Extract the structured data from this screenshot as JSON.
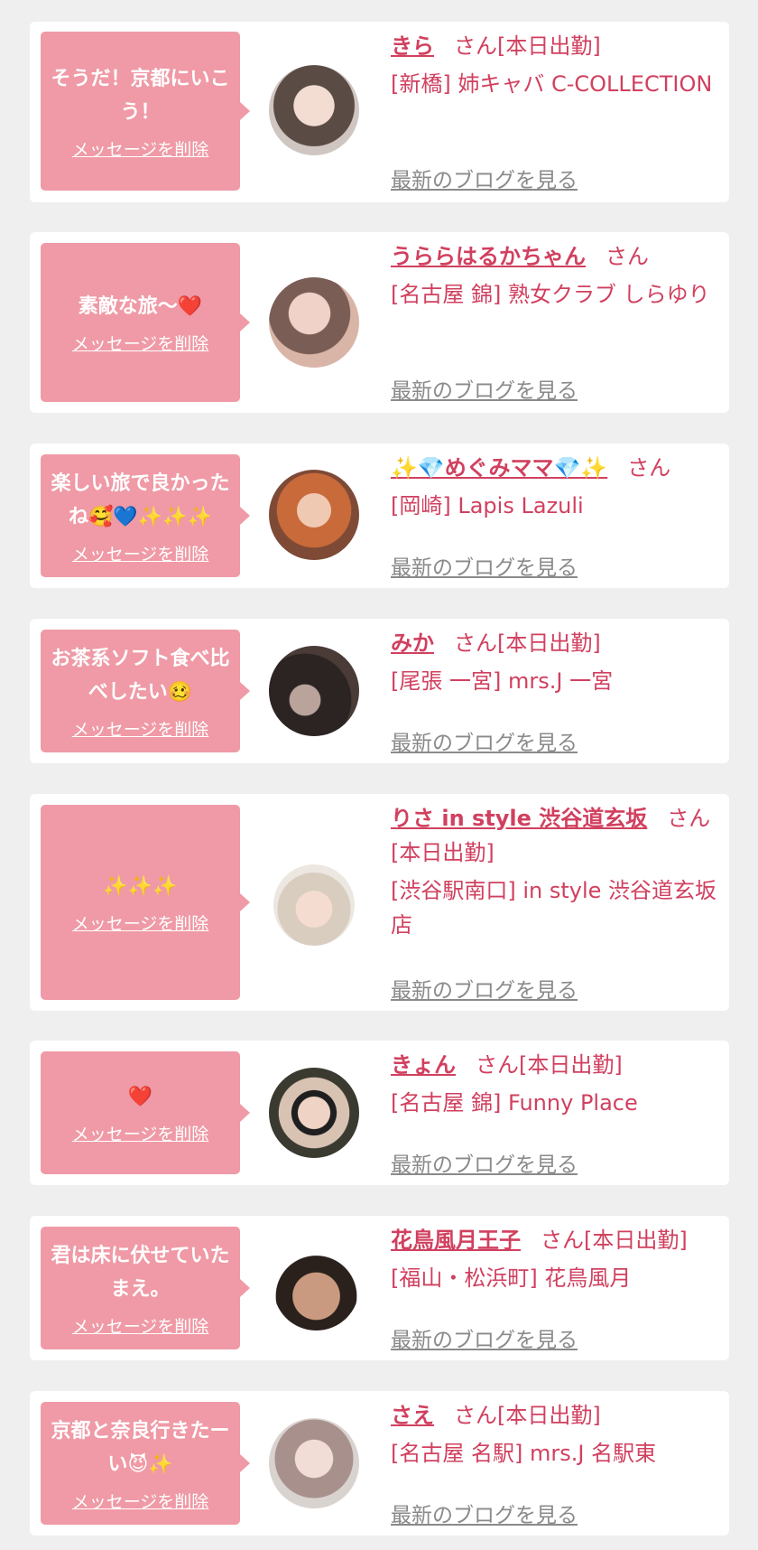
{
  "delete_label": "メッセージを削除",
  "blog_label": "最新のブログを見る",
  "items": [
    {
      "message": "そうだ！京都にいこう！",
      "name": "きら",
      "suffix": "さん[本日出勤]",
      "shop": "[新橋] 姉キャバ C-COLLECTION"
    },
    {
      "message": "素敵な旅〜❤️",
      "name": "うららはるかちゃん",
      "suffix": "さん",
      "shop": "[名古屋 錦] 熟女クラブ しらゆり"
    },
    {
      "message": "楽しい旅で良かったね🥰💙✨✨✨",
      "name": "✨💎めぐみママ💎✨",
      "suffix": "さん",
      "shop": "[岡崎] Lapis Lazuli"
    },
    {
      "message": "お茶系ソフト食べ比べしたい🥴",
      "name": "みか",
      "suffix": "さん[本日出勤]",
      "shop": "[尾張 一宮] mrs.J 一宮"
    },
    {
      "message": "✨✨✨",
      "name": "りさ in style 渋谷道玄坂",
      "suffix": "さん[本日出勤]",
      "shop": "[渋谷駅南口] in style 渋谷道玄坂店"
    },
    {
      "message": "❤️",
      "name": "きょん",
      "suffix": "さん[本日出勤]",
      "shop": "[名古屋 錦] Funny Place"
    },
    {
      "message": "君は床に伏せていたまえ。",
      "name": "花鳥風月王子",
      "suffix": "さん[本日出勤]",
      "shop": "[福山・松浜町] 花鳥風月"
    },
    {
      "message": "京都と奈良行きたーい😈✨",
      "name": "さえ",
      "suffix": "さん[本日出勤]",
      "shop": "[名古屋 名駅] mrs.J 名駅東"
    }
  ]
}
